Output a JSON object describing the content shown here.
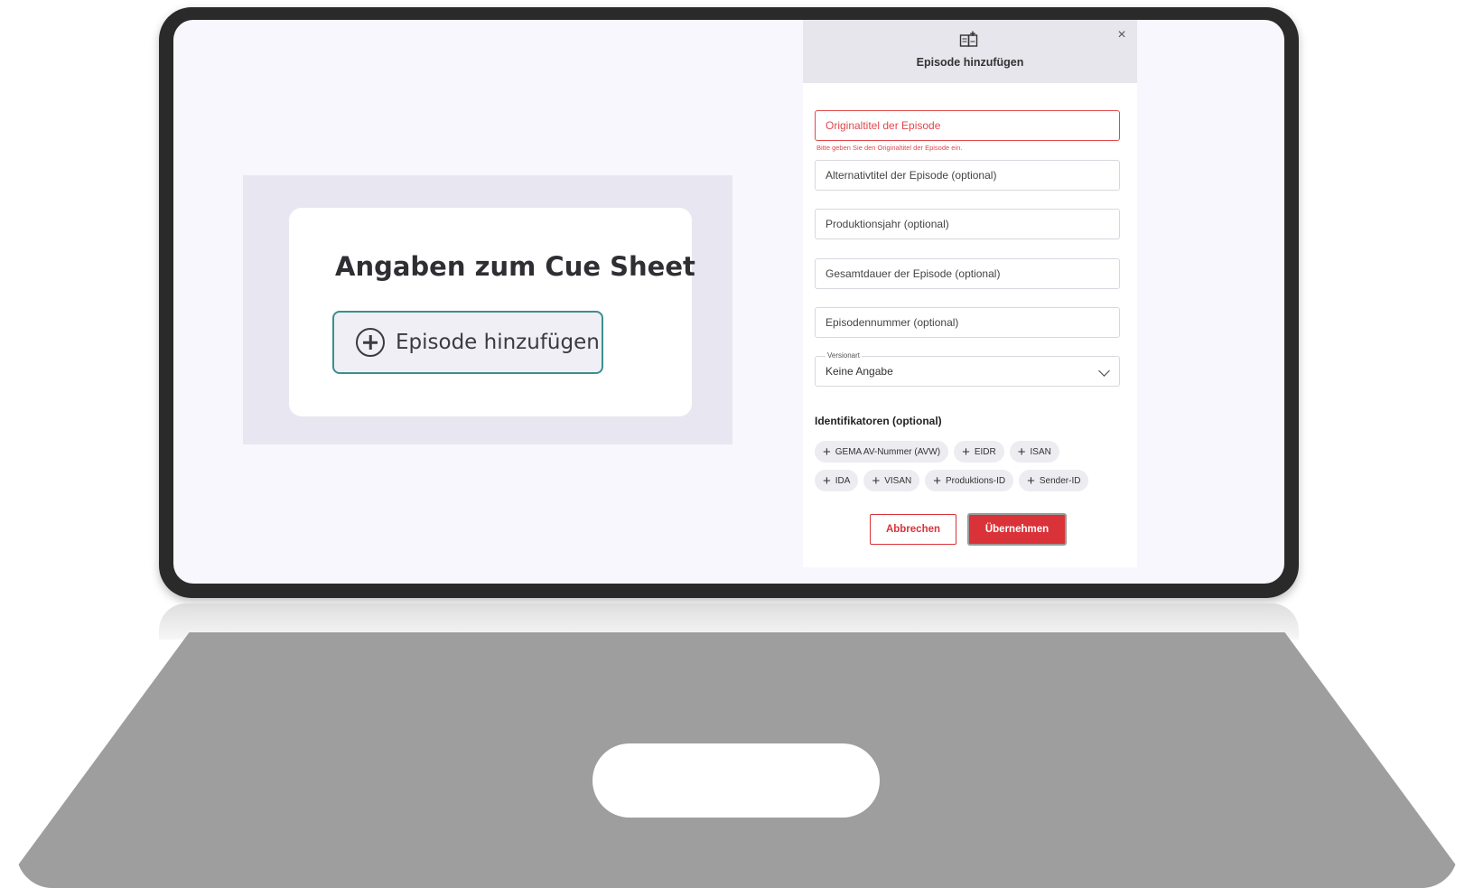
{
  "card": {
    "title": "Angaben zum Cue Sheet",
    "add_episode_label": "Episode hinzufügen"
  },
  "dialog": {
    "title": "Episode hinzufügen",
    "close_label": "×",
    "fields": {
      "original_title": {
        "placeholder": "Originaltitel der Episode",
        "error": "Bitte geben Sie den Originaltitel der Episode ein."
      },
      "alt_title": {
        "placeholder": "Alternativtitel der Episode (optional)"
      },
      "production_year": {
        "placeholder": "Produktionsjahr (optional)"
      },
      "total_duration": {
        "placeholder": "Gesamtdauer der Episode (optional)"
      },
      "episode_number": {
        "placeholder": "Episodennummer (optional)"
      },
      "version_type": {
        "legend": "Versionart",
        "value": "Keine Angabe"
      }
    },
    "identifiers": {
      "heading": "Identifikatoren (optional)",
      "row1": [
        "GEMA AV-Nummer (AVW)",
        "EIDR",
        "ISAN"
      ],
      "row2": [
        "IDA",
        "VISAN",
        "Produktions-ID",
        "Sender-ID"
      ]
    },
    "buttons": {
      "cancel": "Abbrechen",
      "apply": "Übernehmen"
    }
  },
  "colors": {
    "accent_red": "#d93339",
    "error_red": "#e0484b",
    "teal_border": "#3a8f8f",
    "screen_bg": "#f8f7fd"
  },
  "icons": {
    "dialog_icon": "book-add-icon",
    "close": "close-icon",
    "add": "plus-icon",
    "select": "chevron-down-icon"
  }
}
